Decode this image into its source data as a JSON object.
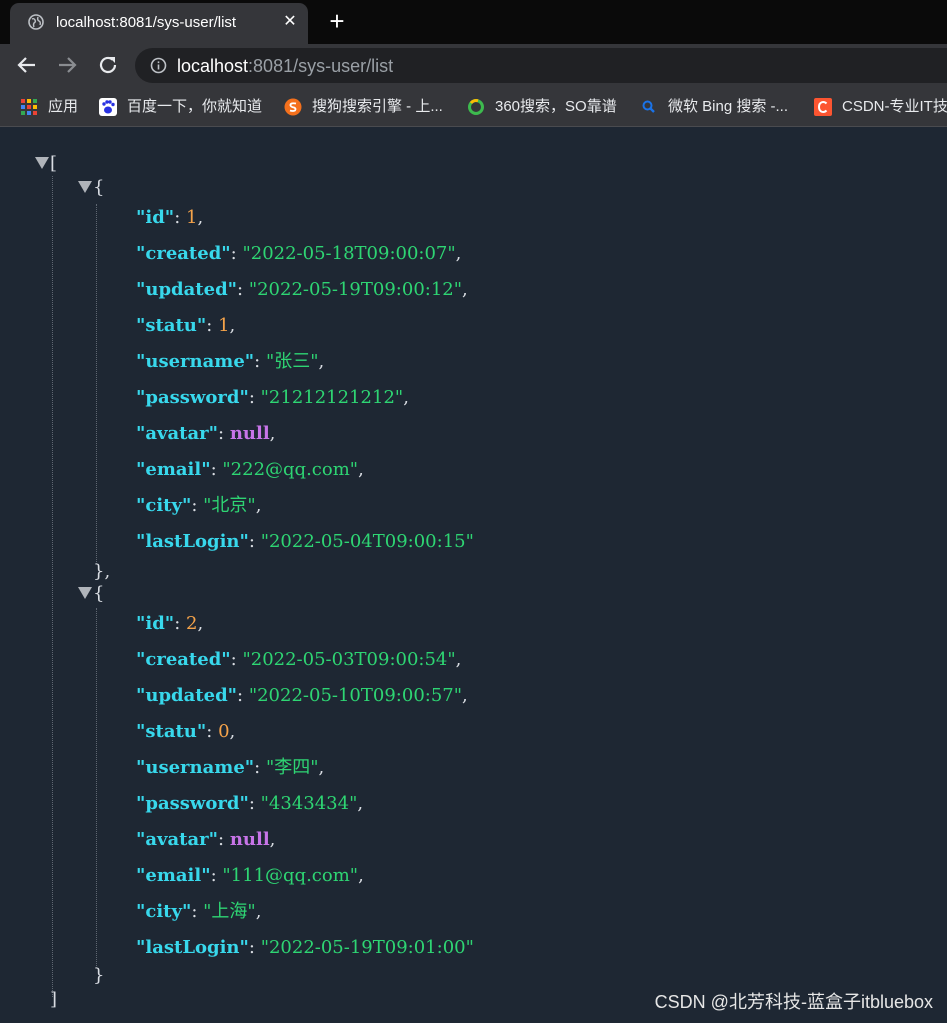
{
  "browser": {
    "tab": {
      "title": "localhost:8081/sys-user/list",
      "close": "✕",
      "favicon": "globe-icon"
    },
    "new_tab": "+",
    "address": {
      "host": "localhost",
      "rest": ":8081/sys-user/list"
    },
    "bookmarks": [
      {
        "label": "应用",
        "icon": "apps-grid-icon"
      },
      {
        "label": "百度一下，你就知道",
        "icon": "baidu-paw-icon"
      },
      {
        "label": "搜狗搜索引擎 - 上...",
        "icon": "sogou-icon"
      },
      {
        "label": "360搜索，SO靠谱",
        "icon": "360-search-icon"
      },
      {
        "label": "微软 Bing 搜索 -...",
        "icon": "bing-search-icon"
      },
      {
        "label": "CSDN-专业IT技",
        "icon": "csdn-icon"
      }
    ]
  },
  "json": {
    "open_bracket": "[",
    "close_bracket": "]",
    "records": [
      {
        "id": "1",
        "created": "\"2022-05-18T09:00:07\"",
        "updated": "\"2022-05-19T09:00:12\"",
        "statu": "1",
        "username": "\"张三\"",
        "password": "\"21212121212\"",
        "avatar": "null",
        "email": "\"222@qq.com\"",
        "city": "\"北京\"",
        "lastLogin": "\"2022-05-04T09:00:15\"",
        "close": "},"
      },
      {
        "id": "2",
        "created": "\"2022-05-03T09:00:54\"",
        "updated": "\"2022-05-10T09:00:57\"",
        "statu": "0",
        "username": "\"李四\"",
        "password": "\"4343434\"",
        "avatar": "null",
        "email": "\"111@qq.com\"",
        "city": "\"上海\"",
        "lastLogin": "\"2022-05-19T09:01:00\"",
        "close": "}"
      }
    ],
    "keys": {
      "id": "\"id\"",
      "created": "\"created\"",
      "updated": "\"updated\"",
      "statu": "\"statu\"",
      "username": "\"username\"",
      "password": "\"password\"",
      "avatar": "\"avatar\"",
      "email": "\"email\"",
      "city": "\"city\"",
      "lastLogin": "\"lastLogin\""
    }
  },
  "watermark": "CSDN @北芳科技-蓝盒子itbluebox",
  "colors": {
    "background": "#1e2733",
    "key": "#38d8ec",
    "string": "#2ed573",
    "number": "#f5a34a",
    "null": "#c774e8"
  }
}
